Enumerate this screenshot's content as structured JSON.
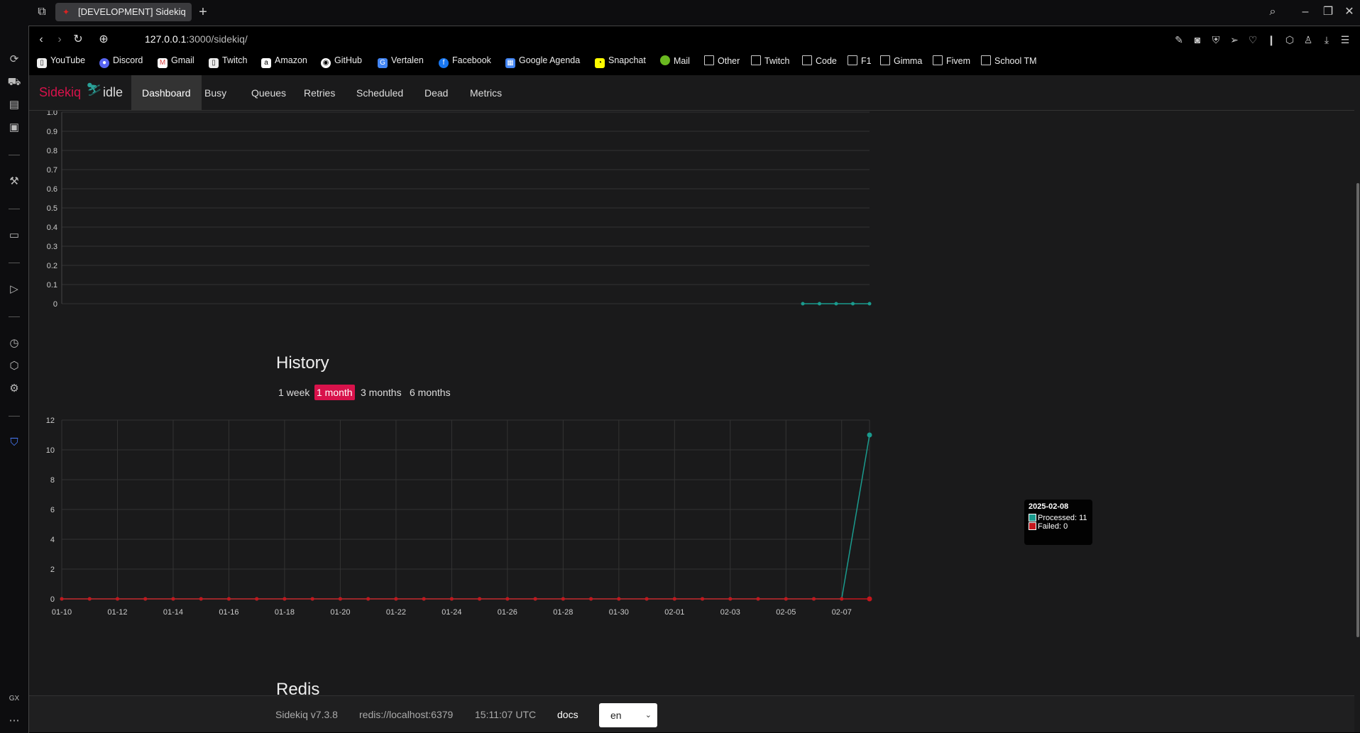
{
  "browser": {
    "tab_title": "[DEVELOPMENT] Sidekiq",
    "url_host": "127.0.0.1",
    "url_rest": ":3000/sidekiq/",
    "bookmarks": [
      "YouTube",
      "Discord",
      "Gmail",
      "Twitch",
      "Amazon",
      "GitHub",
      "Vertalen",
      "Facebook",
      "Google Agenda",
      "Snapchat",
      "Mail",
      "Other",
      "Twitch",
      "Code",
      "F1",
      "Gimma",
      "Fivem",
      "School TM"
    ],
    "rail_bottom_label": "GX"
  },
  "sidekiq": {
    "brand": "Sidekiq",
    "status": "idle",
    "nav": [
      "Dashboard",
      "Busy",
      "Queues",
      "Retries",
      "Scheduled",
      "Dead",
      "Metrics"
    ],
    "active_nav": "Dashboard",
    "history_title": "History",
    "redis_title": "Redis",
    "ranges": [
      "1 week",
      "1 month",
      "3 months",
      "6 months"
    ],
    "active_range": "1 month",
    "footer": {
      "version": "Sidekiq v7.3.8",
      "redis_url": "redis://localhost:6379",
      "time": "15:11:07 UTC",
      "docs": "docs",
      "language": "en"
    },
    "tooltip": {
      "date": "2025-02-08",
      "processed": "Processed: 11",
      "failed": "Failed: 0"
    }
  },
  "colors": {
    "accent": "#d8124b",
    "processed": "#1a9b8e",
    "failed": "#c4161c"
  },
  "chart_data": [
    {
      "type": "line",
      "title": "",
      "ylim": [
        0,
        1.0
      ],
      "y_ticks": [
        "0",
        "0.1",
        "0.2",
        "0.3",
        "0.4",
        "0.5",
        "0.6",
        "0.7",
        "0.8",
        "0.9",
        "1.0"
      ],
      "series": [
        {
          "values": [
            0,
            0,
            0,
            0,
            0
          ]
        }
      ]
    },
    {
      "type": "line",
      "title": "History",
      "ylim": [
        0,
        12
      ],
      "y_ticks": [
        "0",
        "2",
        "4",
        "6",
        "8",
        "10",
        "12"
      ],
      "x_tick_labels": [
        "01-10",
        "01-12",
        "01-14",
        "01-16",
        "01-18",
        "01-20",
        "01-22",
        "01-24",
        "01-26",
        "01-28",
        "01-30",
        "02-01",
        "02-03",
        "02-05",
        "02-07"
      ],
      "x": [
        "01-10",
        "01-11",
        "01-12",
        "01-13",
        "01-14",
        "01-15",
        "01-16",
        "01-17",
        "01-18",
        "01-19",
        "01-20",
        "01-21",
        "01-22",
        "01-23",
        "01-24",
        "01-25",
        "01-26",
        "01-27",
        "01-28",
        "01-29",
        "01-30",
        "01-31",
        "02-01",
        "02-02",
        "02-03",
        "02-04",
        "02-05",
        "02-06",
        "02-07",
        "02-08"
      ],
      "series": [
        {
          "name": "Processed",
          "values": [
            0,
            0,
            0,
            0,
            0,
            0,
            0,
            0,
            0,
            0,
            0,
            0,
            0,
            0,
            0,
            0,
            0,
            0,
            0,
            0,
            0,
            0,
            0,
            0,
            0,
            0,
            0,
            0,
            0,
            11
          ]
        },
        {
          "name": "Failed",
          "values": [
            0,
            0,
            0,
            0,
            0,
            0,
            0,
            0,
            0,
            0,
            0,
            0,
            0,
            0,
            0,
            0,
            0,
            0,
            0,
            0,
            0,
            0,
            0,
            0,
            0,
            0,
            0,
            0,
            0,
            0
          ]
        }
      ]
    }
  ]
}
